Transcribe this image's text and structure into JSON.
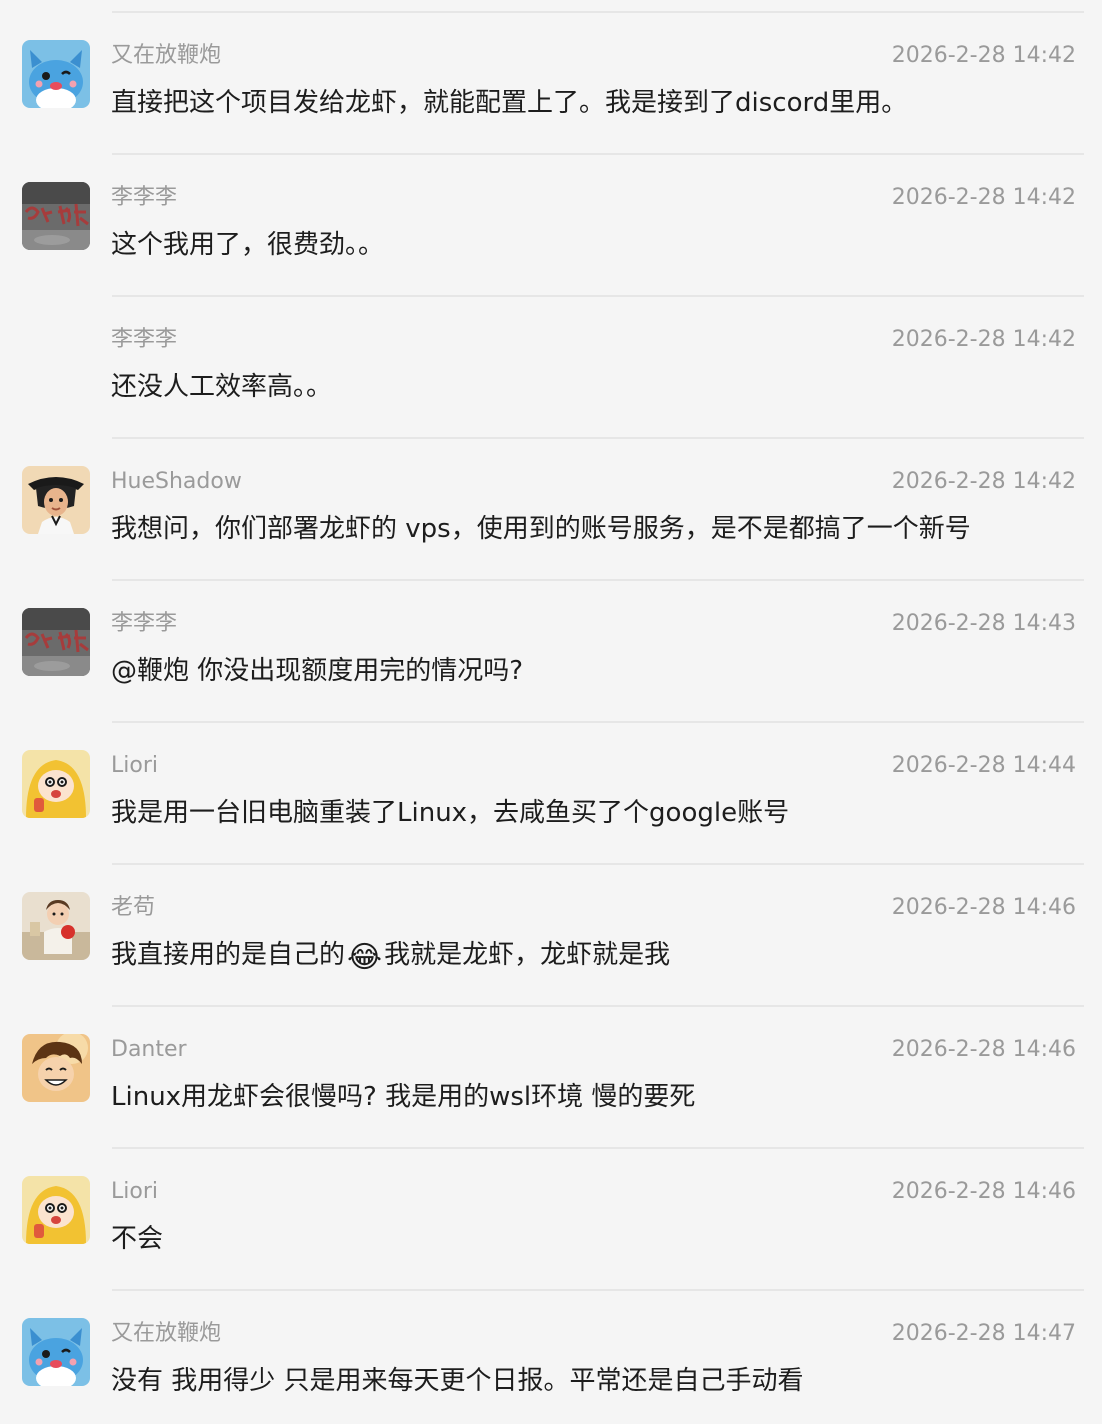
{
  "messages": [
    {
      "avatar": "blue-cat-avatar",
      "name": "又在放鞭炮",
      "time": "2026-2-28 14:42",
      "text": "直接把这个项目发给龙虾，就能配置上了。我是接到了discord里用。"
    },
    {
      "avatar": "calligraphy-avatar",
      "name": "李李李",
      "time": "2026-2-28 14:42",
      "text": "这个我用了，很费劲。。"
    },
    {
      "avatar": "",
      "name": "李李李",
      "time": "2026-2-28 14:42",
      "text": "还没人工效率高。。"
    },
    {
      "avatar": "hat-girl-avatar",
      "name": "HueShadow",
      "time": "2026-2-28 14:42",
      "text": "我想问，你们部署龙虾的 vps，使用到的账号服务，是不是都搞了一个新号"
    },
    {
      "avatar": "calligraphy-avatar",
      "name": "李李李",
      "time": "2026-2-28 14:43",
      "text": "@鞭炮  你没出现额度用完的情况吗?"
    },
    {
      "avatar": "yellow-raincoat-kid-avatar",
      "name": "Liori",
      "time": "2026-2-28 14:44",
      "text": "我是用一台旧电脑重装了Linux，去咸鱼买了个google账号"
    },
    {
      "avatar": "apple-girl-avatar",
      "name": "老苟",
      "time": "2026-2-28 14:46",
      "text_before_emoji": "我直接用的是自己的",
      "emoji": "😂",
      "text_after_emoji": "我就是龙虾，龙虾就是我"
    },
    {
      "avatar": "anime-boy-avatar",
      "name": "Danter",
      "time": "2026-2-28 14:46",
      "text": "Linux用龙虾会很慢吗?  我是用的wsl环境 慢的要死"
    },
    {
      "avatar": "yellow-raincoat-kid-avatar",
      "name": "Liori",
      "time": "2026-2-28 14:46",
      "text": "不会"
    },
    {
      "avatar": "blue-cat-avatar",
      "name": "又在放鞭炮",
      "time": "2026-2-28 14:47",
      "text": "没有 我用得少 只是用来每天更个日报。平常还是自己手动看"
    }
  ],
  "colors": {
    "background": "#f5f5f5",
    "divider": "#e6e6e6",
    "meta_text": "#9a9a9a",
    "body_text": "#1d1d1d"
  }
}
